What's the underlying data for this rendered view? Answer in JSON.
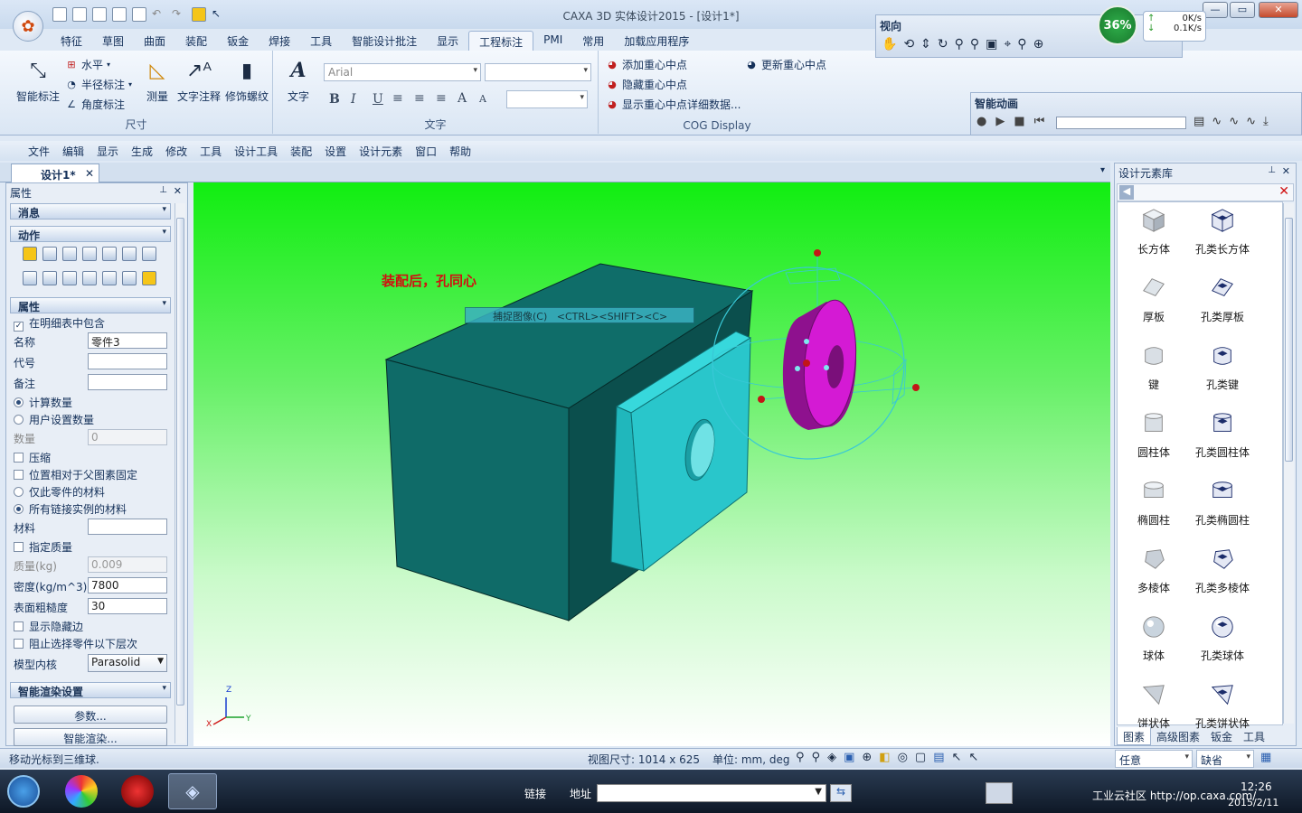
{
  "app": {
    "title": "CAXA 3D 实体设计2015 - [设计1*]"
  },
  "tabs": [
    "特征",
    "草图",
    "曲面",
    "装配",
    "钣金",
    "焊接",
    "工具",
    "智能设计批注",
    "显示",
    "工程标注",
    "PMI",
    "常用",
    "加载应用程序"
  ],
  "active_tab": "工程标注",
  "ribbon": {
    "dim": {
      "label": "尺寸",
      "smart": "智能标注",
      "horizontal": "水平",
      "radius": "半径标注",
      "angle": "角度标注",
      "measure": "测量",
      "text_annot": "文字注释",
      "thread": "修饰螺纹"
    },
    "text": {
      "label": "文字",
      "text_btn": "文字",
      "font": "Arial",
      "bold": "B",
      "italic": "I",
      "underline": "U"
    },
    "cog": {
      "label": "COG Display",
      "add": "添加重心中点",
      "hide": "隐藏重心中点",
      "show_detail": "显示重心中点详细数据...",
      "update": "更新重心中点"
    }
  },
  "view_panel": {
    "title": "视向"
  },
  "anim_panel": {
    "title": "智能动画"
  },
  "netmon": {
    "percent": "36%",
    "up": "0K/s",
    "down": "0.1K/s"
  },
  "menubar": [
    "文件",
    "编辑",
    "显示",
    "生成",
    "修改",
    "工具",
    "设计工具",
    "装配",
    "设置",
    "设计元素",
    "窗口",
    "帮助"
  ],
  "doc_tab": "设计1*",
  "left_panel": {
    "title": "属性",
    "sec_msg": "消息",
    "sec_action": "动作",
    "sec_props": "属性",
    "include_detail": "在明细表中包含",
    "name_label": "名称",
    "name_value": "零件3",
    "code_label": "代号",
    "code_value": "",
    "note_label": "备注",
    "note_value": "",
    "calc_qty": "计算数量",
    "user_qty": "用户设置数量",
    "qty_label": "数量",
    "qty_value": "0",
    "compress": "压缩",
    "pos_fixed": "位置相对于父图素固定",
    "only_mat": "仅此零件的材料",
    "all_mat": "所有链接实例的材料",
    "mat_label": "材料",
    "mat_value": "",
    "mass_spec": "指定质量",
    "mass_label": "质量(kg)",
    "mass_value": "0.009",
    "density_label": "密度(kg/m^3)",
    "density_value": "7800",
    "rough_label": "表面粗糙度",
    "rough_value": "30",
    "show_hidden": "显示隐藏边",
    "block_select": "阻止选择零件以下层次",
    "kernel_label": "模型内核",
    "kernel_value": "Parasolid",
    "sec_render": "智能渲染设置",
    "params_btn": "参数...",
    "render_btn": "智能渲染..."
  },
  "viewport": {
    "annotation": "装配后，孔同心",
    "tooltip": "捕捉图像(C)   <CTRL><SHIFT><C>",
    "axis_z": "Z",
    "axis_y": "Y",
    "axis_x": "X",
    "colors": {
      "box": "#0e6e6a",
      "plate": "#27c3c9",
      "ring": "#d41ad4",
      "bg_top": "#11ee11"
    }
  },
  "right_panel": {
    "title": "设计元素库",
    "items": [
      {
        "label": "长方体",
        "shape": "cube"
      },
      {
        "label": "孔类长方体",
        "shape": "cube-hole"
      },
      {
        "label": "厚板",
        "shape": "plate"
      },
      {
        "label": "孔类厚板",
        "shape": "plate-hole"
      },
      {
        "label": "键",
        "shape": "key"
      },
      {
        "label": "孔类键",
        "shape": "key-hole"
      },
      {
        "label": "圆柱体",
        "shape": "cylinder"
      },
      {
        "label": "孔类圆柱体",
        "shape": "cylinder-hole"
      },
      {
        "label": "椭圆柱",
        "shape": "ellipse"
      },
      {
        "label": "孔类椭圆柱",
        "shape": "ellipse-hole"
      },
      {
        "label": "多棱体",
        "shape": "prism"
      },
      {
        "label": "孔类多棱体",
        "shape": "prism-hole"
      },
      {
        "label": "球体",
        "shape": "sphere"
      },
      {
        "label": "孔类球体",
        "shape": "sphere-hole"
      },
      {
        "label": "饼状体",
        "shape": "pie"
      },
      {
        "label": "孔类饼状体",
        "shape": "pie-hole"
      }
    ],
    "tabs": [
      "图素",
      "高级图素",
      "钣金",
      "工具"
    ]
  },
  "status": {
    "hint": "移动光标到三维球.",
    "viewsize": "视图尺寸: 1014 x 625",
    "unit": "单位: mm, deg",
    "filter": "任意",
    "default": "缺省"
  },
  "taskbar": {
    "link": "链接",
    "address": "地址",
    "time": "12:26",
    "date": "2015/2/11",
    "site": "工业云社区 http://op.caxa.com/"
  }
}
